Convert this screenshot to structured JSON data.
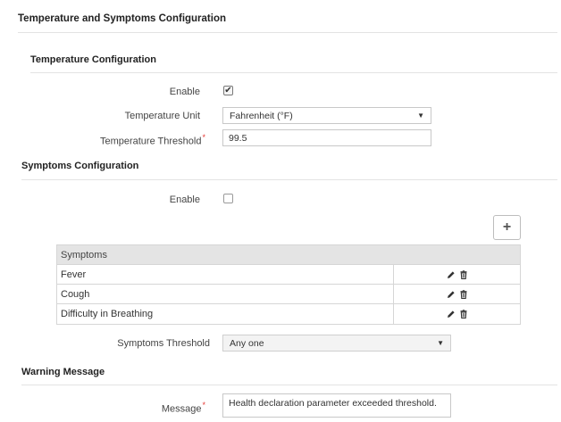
{
  "page": {
    "title": "Temperature and Symptoms Configuration"
  },
  "temperature": {
    "section_title": "Temperature Configuration",
    "enable_label": "Enable",
    "enabled": true,
    "unit_label": "Temperature Unit",
    "unit_value": "Fahrenheit (°F)",
    "threshold_label": "Temperature Threshold",
    "threshold_value": "99.5"
  },
  "symptoms": {
    "section_title": "Symptoms Configuration",
    "enable_label": "Enable",
    "enabled": false,
    "add_label": "+",
    "table_header": "Symptoms",
    "rows": [
      {
        "name": "Fever"
      },
      {
        "name": "Cough"
      },
      {
        "name": "Difficulty in Breathing"
      }
    ],
    "threshold_label": "Symptoms Threshold",
    "threshold_value": "Any one"
  },
  "warning": {
    "section_title": "Warning Message",
    "message_label": "Message",
    "message_value": "Health declaration parameter exceeded threshold."
  },
  "required_mark": "*",
  "check_glyph": "✔",
  "icons": {
    "edit": "pencil-icon",
    "delete": "trash-icon",
    "dropdown": "caret-down-icon",
    "check": "check-icon"
  }
}
